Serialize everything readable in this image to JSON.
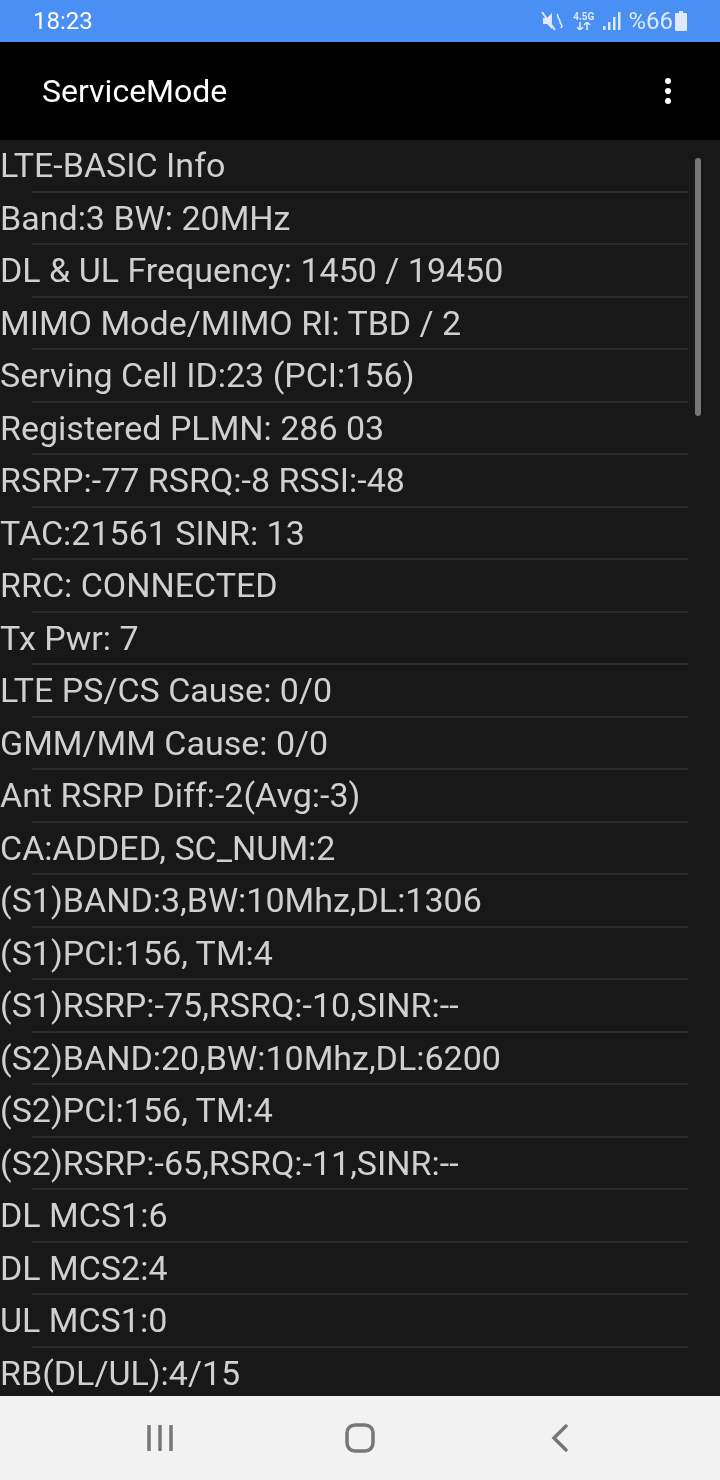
{
  "status_bar": {
    "time": "18:23",
    "network_type": "4.5G",
    "battery": "%66"
  },
  "app_bar": {
    "title": "ServiceMode"
  },
  "rows": [
    "LTE-BASIC Info",
    "Band:3 BW: 20MHz",
    "DL & UL Frequency: 1450 / 19450",
    "MIMO Mode/MIMO RI: TBD / 2",
    "Serving Cell ID:23 (PCI:156)",
    "Registered PLMN: 286 03",
    "RSRP:-77 RSRQ:-8 RSSI:-48",
    "TAC:21561 SINR: 13",
    "RRC: CONNECTED",
    "Tx Pwr: 7",
    "LTE PS/CS Cause: 0/0",
    "GMM/MM Cause: 0/0",
    "Ant RSRP Diff:-2(Avg:-3)",
    "CA:ADDED, SC_NUM:2",
    "(S1)BAND:3,BW:10Mhz,DL:1306",
    "(S1)PCI:156, TM:4",
    "(S1)RSRP:-75,RSRQ:-10,SINR:--",
    "(S2)BAND:20,BW:10Mhz,DL:6200",
    "(S2)PCI:156, TM:4",
    "(S2)RSRP:-65,RSRQ:-11,SINR:--",
    "DL MCS1:6",
    "DL MCS2:4",
    "UL MCS1:0",
    "RB(DL/UL):4/15"
  ]
}
